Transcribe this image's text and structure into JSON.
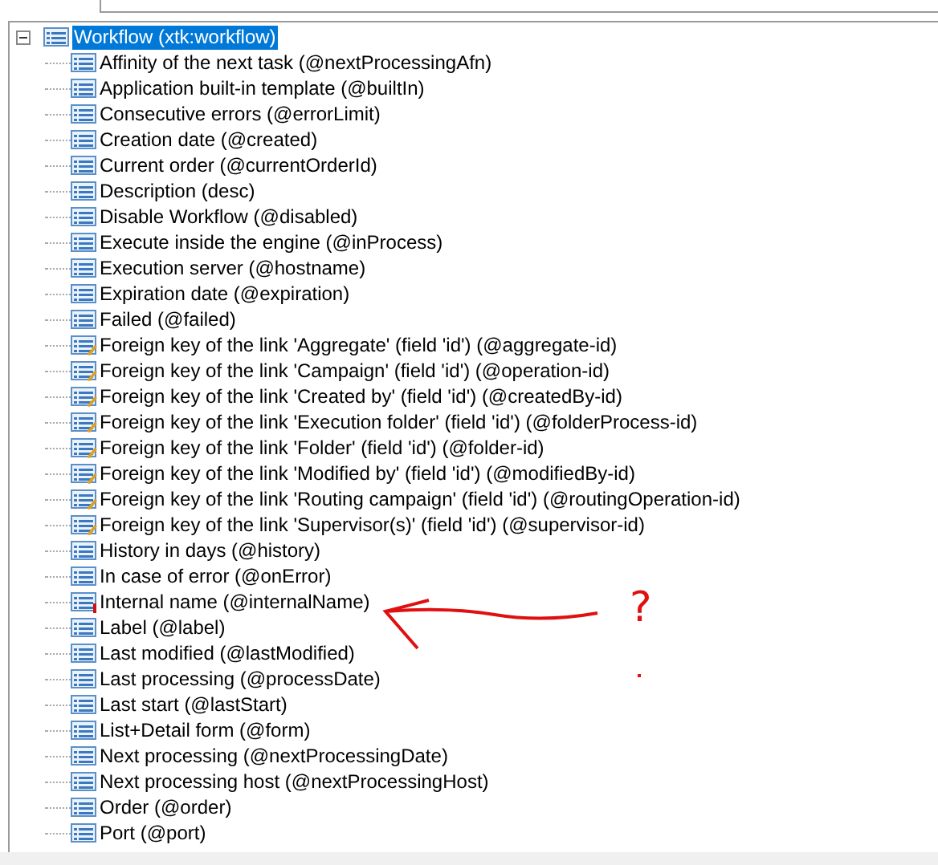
{
  "tree": {
    "root": {
      "label": "Workflow (xtk:workflow)",
      "expanded": true,
      "selected": true,
      "children": [
        {
          "kind": "attr",
          "label": "Affinity of the next task (@nextProcessingAfn)"
        },
        {
          "kind": "attr",
          "label": "Application built-in template (@builtIn)"
        },
        {
          "kind": "attr",
          "label": "Consecutive errors (@errorLimit)"
        },
        {
          "kind": "attr",
          "label": "Creation date (@created)"
        },
        {
          "kind": "attr",
          "label": "Current order (@currentOrderId)"
        },
        {
          "kind": "attr",
          "label": "Description (desc)"
        },
        {
          "kind": "attr",
          "label": "Disable Workflow (@disabled)"
        },
        {
          "kind": "attr",
          "label": "Execute inside the engine (@inProcess)"
        },
        {
          "kind": "attr",
          "label": "Execution server (@hostname)"
        },
        {
          "kind": "attr",
          "label": "Expiration date (@expiration)"
        },
        {
          "kind": "attr",
          "label": "Failed (@failed)"
        },
        {
          "kind": "key",
          "label": "Foreign key of the link 'Aggregate' (field 'id') (@aggregate-id)"
        },
        {
          "kind": "key",
          "label": "Foreign key of the link 'Campaign' (field 'id') (@operation-id)"
        },
        {
          "kind": "key",
          "label": "Foreign key of the link 'Created by' (field 'id') (@createdBy-id)"
        },
        {
          "kind": "key",
          "label": "Foreign key of the link 'Execution folder' (field 'id') (@folderProcess-id)"
        },
        {
          "kind": "key",
          "label": "Foreign key of the link 'Folder' (field 'id') (@folder-id)"
        },
        {
          "kind": "key",
          "label": "Foreign key of the link 'Modified by' (field 'id') (@modifiedBy-id)"
        },
        {
          "kind": "key",
          "label": "Foreign key of the link 'Routing campaign' (field 'id') (@routingOperation-id)"
        },
        {
          "kind": "key",
          "label": "Foreign key of the link 'Supervisor(s)' (field 'id') (@supervisor-id)"
        },
        {
          "kind": "attr",
          "label": "History in days (@history)"
        },
        {
          "kind": "attr",
          "label": "In case of error (@onError)"
        },
        {
          "kind": "required",
          "label": "Internal name (@internalName)"
        },
        {
          "kind": "attr",
          "label": "Label (@label)"
        },
        {
          "kind": "attr",
          "label": "Last modified (@lastModified)"
        },
        {
          "kind": "attr",
          "label": "Last processing (@processDate)"
        },
        {
          "kind": "attr",
          "label": "Last start (@lastStart)"
        },
        {
          "kind": "attr",
          "label": "List+Detail form (@form)"
        },
        {
          "kind": "attr",
          "label": "Next processing (@nextProcessingDate)"
        },
        {
          "kind": "attr",
          "label": "Next processing host (@nextProcessingHost)"
        },
        {
          "kind": "attr",
          "label": "Order (@order)"
        },
        {
          "kind": "attr",
          "label": "Port (@port)"
        }
      ]
    }
  },
  "annotation": {
    "text": "?"
  }
}
